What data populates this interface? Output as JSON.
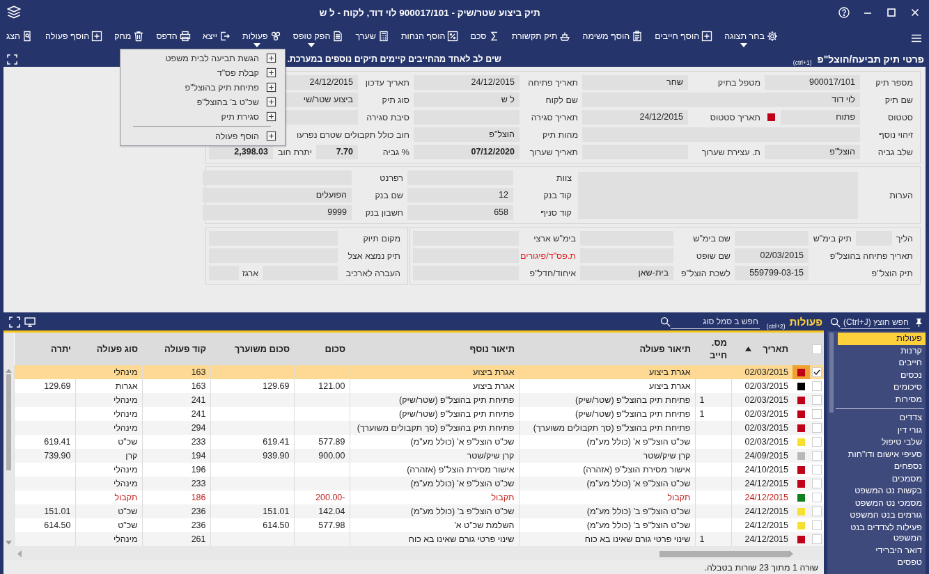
{
  "window": {
    "title": "תיק ביצוע שטר/שיק - 900017/101 לוי דוד, לקוח - ל ש"
  },
  "toolbar": [
    {
      "label": "בחר תצוגה",
      "dropdown": true
    },
    {
      "label": "הוסף חייבים",
      "dropdown": false
    },
    {
      "label": "הוסף משימה",
      "dropdown": false
    },
    {
      "label": "תיק תקשורת",
      "dropdown": false
    },
    {
      "label": "סכם",
      "dropdown": false
    },
    {
      "label": "הוסף הנחות",
      "dropdown": false
    },
    {
      "label": "שערך",
      "dropdown": false
    },
    {
      "label": "הפק טופס",
      "dropdown": true
    },
    {
      "label": "פעולות",
      "dropdown": true
    },
    {
      "label": "ייצא",
      "dropdown": false
    },
    {
      "label": "הדפס",
      "dropdown": false
    },
    {
      "label": "מחק",
      "dropdown": false
    },
    {
      "label": "הוסף פעולה",
      "dropdown": false
    },
    {
      "label": "הצג",
      "dropdown": false
    }
  ],
  "section_header": {
    "title": "פרטי תיק תביעה/הוצל\"פ",
    "shortcut": "(ctrl+1)",
    "notice": "שים לב לאחד מהחייבים קיימים תיקים נוספים במערכת."
  },
  "actions_menu": {
    "items": [
      {
        "label": "הגשת תביעה לבית משפט"
      },
      {
        "label": "קבלת פס\"ד"
      },
      {
        "label": "פתיחת תיק בהוצל\"פ"
      },
      {
        "label": "שכ\"ט ב' בהוצל\"פ"
      },
      {
        "label": "סגירת תיק"
      }
    ],
    "footer_item": {
      "label": "הוסף פעולה"
    }
  },
  "case_details": {
    "general": [
      {
        "label": "מספר תיק",
        "value": "900017/101",
        "kind": "field"
      },
      {
        "label": "מטפל בתיק",
        "value": "שחר",
        "kind": "field"
      },
      {
        "label": "תאריך פתיחה",
        "value": "24/12/2015",
        "kind": "field"
      },
      {
        "label": "תאריך עדכון",
        "value": "24/12/2015",
        "kind": "wide"
      },
      {
        "label": "שם תיק",
        "value": "לוי דוד",
        "kind": "wide"
      },
      {
        "label": "שם לקוח",
        "value": "ל ש",
        "kind": "field"
      },
      {
        "label": "סוג תיק",
        "value": "ביצוע שטר/שי",
        "kind": "wide"
      },
      {
        "label": "סטטוס",
        "value": "פתוח",
        "kind": "status",
        "color": "#c00018"
      },
      {
        "label": "תאריך סטטוס",
        "value": "24/12/2015",
        "kind": "field"
      },
      {
        "label": "תאריך סגירה",
        "kind": "field"
      },
      {
        "label": "סיבת סגירה",
        "kind": "wide"
      },
      {
        "label": "זיהוי נוסף",
        "kind": "wide"
      },
      {
        "label": "מהות תיק",
        "value": "הוצל\"פ",
        "kind": "field"
      },
      {
        "label": "חוב כולל תקבולים שטרם נפרעו",
        "kind": "label_only"
      },
      {
        "label": "שלב גביה",
        "value": "הוצל\"פ",
        "kind": "field"
      },
      {
        "label": "ת. עצירת שערוך",
        "kind": "field"
      },
      {
        "label": "תאריך שערוך",
        "value": "07/12/2020",
        "kind": "field",
        "bold": true
      },
      {
        "label": "% גביה",
        "value": "7.70",
        "kind": "field",
        "bold": true
      },
      {
        "label": "יתרת חוב",
        "value": "2,398.03",
        "kind": "field",
        "bold": true
      }
    ],
    "bank": {
      "notes": {
        "label": "הערות"
      },
      "fields": [
        {
          "label": "צוות",
          "kind": "field"
        },
        {
          "label": "רפרנט",
          "kind": "wide"
        },
        {
          "label": "קוד בנק",
          "value": "12",
          "kind": "field"
        },
        {
          "label": "שם בנק",
          "value": "הפועלים",
          "kind": "wide"
        },
        {
          "label": "קוד סניף",
          "value": "658",
          "kind": "field"
        },
        {
          "label": "חשבון בנק",
          "value": "9999",
          "kind": "wide"
        }
      ]
    },
    "court": [
      {
        "label": "הליך",
        "kind": "field"
      },
      {
        "label": "תיק בימ\"ש",
        "kind": "field"
      },
      {
        "label": "שם בימ\"ש",
        "kind": "field"
      },
      {
        "label": "בימ\"ש ארצי",
        "kind": "field"
      },
      {
        "label": "תאריך פתיחה בהוצל\"פ",
        "value": "02/03/2015",
        "kind": "long_label"
      },
      {
        "label": "שם שופט",
        "kind": "field"
      },
      {
        "label": "ת.פס\"ד/פיגורים",
        "kind": "field",
        "alert": true
      },
      {
        "label": "תיק הוצל\"פ",
        "value": "559799-03-15",
        "kind": "long_label"
      },
      {
        "label": "לשכת הוצל\"פ",
        "value": "בית-שאן",
        "kind": "field"
      },
      {
        "label": "איחוד/חדל\"פ",
        "kind": "field"
      }
    ],
    "archive": [
      {
        "label": "מקום תיוק",
        "kind": "wide"
      },
      {
        "label": "תיק נמצא אצל",
        "kind": "wide"
      },
      {
        "label": "העברה לארכיב",
        "kind": "field"
      },
      {
        "label": "ארגז",
        "kind": "field"
      }
    ]
  },
  "sidebar": {
    "search": {
      "placeholder": "חפש חוצץ (Ctrl+J)"
    },
    "groups": [
      [
        {
          "label": "פעולות",
          "selected": true
        },
        {
          "label": "קרנות",
          "selected": false
        },
        {
          "label": "חייבים",
          "selected": false
        },
        {
          "label": "נכסים",
          "selected": false
        },
        {
          "label": "סיכומים",
          "selected": false
        },
        {
          "label": "מסירות",
          "selected": false
        }
      ],
      [
        {
          "label": "צדדים",
          "selected": false
        },
        {
          "label": "גורי דין",
          "selected": false
        },
        {
          "label": "שלבי טיפול",
          "selected": false
        },
        {
          "label": "סעיפי אישום ודו\"חות",
          "selected": false
        },
        {
          "label": "נספחים",
          "selected": false
        },
        {
          "label": "מסמכים",
          "selected": false
        },
        {
          "label": "בקשות נט המשפט",
          "selected": false
        },
        {
          "label": "מסמכי נט המשפט",
          "selected": false
        },
        {
          "label": "גורמים בנט המשפט",
          "selected": false
        },
        {
          "label": "פעילות לצדדים בנט המשפט",
          "selected": false
        },
        {
          "label": "דואר היברידי",
          "selected": false
        },
        {
          "label": "טפסים",
          "selected": false
        }
      ]
    ]
  },
  "actions_table": {
    "title": "פעולות",
    "shortcut": "(ctrl+2)",
    "search": {
      "placeholder": "חפש ב סמל סוג"
    },
    "select_all_checked": false,
    "columns": [
      {
        "label": "תאריך",
        "sort_ascending": true
      },
      {
        "label": "מס. חייב"
      },
      {
        "label": "תיאור פעולה"
      },
      {
        "label": "תיאור נוסף"
      },
      {
        "label": "סכום"
      },
      {
        "label": "סכום משוערך"
      },
      {
        "label": "קוד פעולה"
      },
      {
        "label": "סוג פעולה"
      },
      {
        "label": "יתרה"
      }
    ],
    "rows": [
      {
        "selected": true,
        "checked": true,
        "color": "#c00018",
        "alert": false,
        "cells": [
          "02/03/2015",
          null,
          "אגרת ביצוע",
          "אגרת ביצוע",
          null,
          null,
          "163",
          "מינהלי",
          null
        ]
      },
      {
        "selected": false,
        "checked": false,
        "color": "#000000",
        "alert": false,
        "cells": [
          "02/03/2015",
          null,
          "אגרת ביצוע",
          "אגרת ביצוע",
          "121.00",
          "129.69",
          "163",
          "אגרות",
          "129.69"
        ]
      },
      {
        "selected": false,
        "checked": false,
        "color": "#c00018",
        "alert": false,
        "cells": [
          "02/03/2015",
          "1",
          "פתיחת תיק בהוצל\"פ (שטר/שיק)",
          "פתיחת תיק בהוצל\"פ (שטר/שיק)",
          null,
          null,
          "241",
          "מינהלי",
          null
        ]
      },
      {
        "selected": false,
        "checked": false,
        "color": "#c00018",
        "alert": false,
        "cells": [
          "02/03/2015",
          "1",
          "פתיחת תיק בהוצל\"פ (שטר/שיק)",
          "פתיחת תיק בהוצל\"פ (שטר/שיק)",
          null,
          null,
          "241",
          "מינהלי",
          null
        ]
      },
      {
        "selected": false,
        "checked": false,
        "color": "#c00018",
        "alert": false,
        "cells": [
          "02/03/2015",
          null,
          "פתיחת תיק בהוצל\"פ (סך תקבולים משוערך)",
          "פתיחת תיק בהוצל\"פ (סך תקבולים משוערך)",
          null,
          null,
          "294",
          "מינהלי",
          null
        ]
      },
      {
        "selected": false,
        "checked": false,
        "color": "#f8e030",
        "alert": false,
        "cells": [
          "02/03/2015",
          null,
          "שכ\"ט הוצל\"פ א' (כולל מע\"מ)",
          "שכ\"ט הוצל\"פ א' (כולל מע\"מ)",
          "577.89",
          "619.41",
          "233",
          "שכ\"ט",
          "619.41"
        ]
      },
      {
        "selected": false,
        "checked": false,
        "color": "#b8b8b8",
        "alert": false,
        "cells": [
          "24/09/2015",
          null,
          "קרן שיק/שטר",
          "קרן שיק/שטר",
          "900.00",
          "939.90",
          "194",
          "קרן",
          "739.90"
        ]
      },
      {
        "selected": false,
        "checked": false,
        "color": "#c00018",
        "alert": false,
        "cells": [
          "24/10/2015",
          null,
          "אישור מסירת הוצל\"פ (אזהרה)",
          "אישור מסירת הוצל\"פ (אזהרה)",
          null,
          null,
          "196",
          "מינהלי",
          null
        ]
      },
      {
        "selected": false,
        "checked": false,
        "color": "#c00018",
        "alert": false,
        "cells": [
          "24/12/2015",
          null,
          "שכ\"ט הוצל\"פ א' (כולל מע\"מ)",
          "שכ\"ט הוצל\"פ א' (כולל מע\"מ)",
          null,
          null,
          "233",
          "מינהלי",
          null
        ]
      },
      {
        "selected": false,
        "checked": false,
        "color": "#108020",
        "alert": true,
        "cells": [
          "24/12/2015",
          null,
          "תקבול",
          "תקבול",
          "-200.00",
          null,
          "186",
          "תקבול",
          null
        ]
      },
      {
        "selected": false,
        "checked": false,
        "color": "#f8e030",
        "alert": false,
        "cells": [
          "24/12/2015",
          null,
          "שכ\"ט הוצל\"פ ב' (כולל מע\"מ)",
          "שכ\"ט הוצל\"פ ב' (כולל מע\"מ)",
          "142.04",
          "151.01",
          "236",
          "שכ\"ט",
          "151.01"
        ]
      },
      {
        "selected": false,
        "checked": false,
        "color": "#f8e030",
        "alert": false,
        "cells": [
          "24/12/2015",
          null,
          "שכ\"ט הוצל\"פ ב' (כולל מע\"מ)",
          "השלמת שכ\"ט א'",
          "577.98",
          "614.50",
          "236",
          "שכ\"ט",
          "614.50"
        ]
      },
      {
        "selected": false,
        "checked": false,
        "color": "#c00018",
        "alert": false,
        "cells": [
          "24/12/2015",
          "1",
          "שינוי פרטי גורם שאינו בא כוח",
          "שינוי פרטי גורם שאינו בא כוח",
          null,
          null,
          "261",
          "מינהלי",
          null
        ]
      }
    ],
    "status": "שורה 1 מתוך 23 שורות בטבלה."
  }
}
